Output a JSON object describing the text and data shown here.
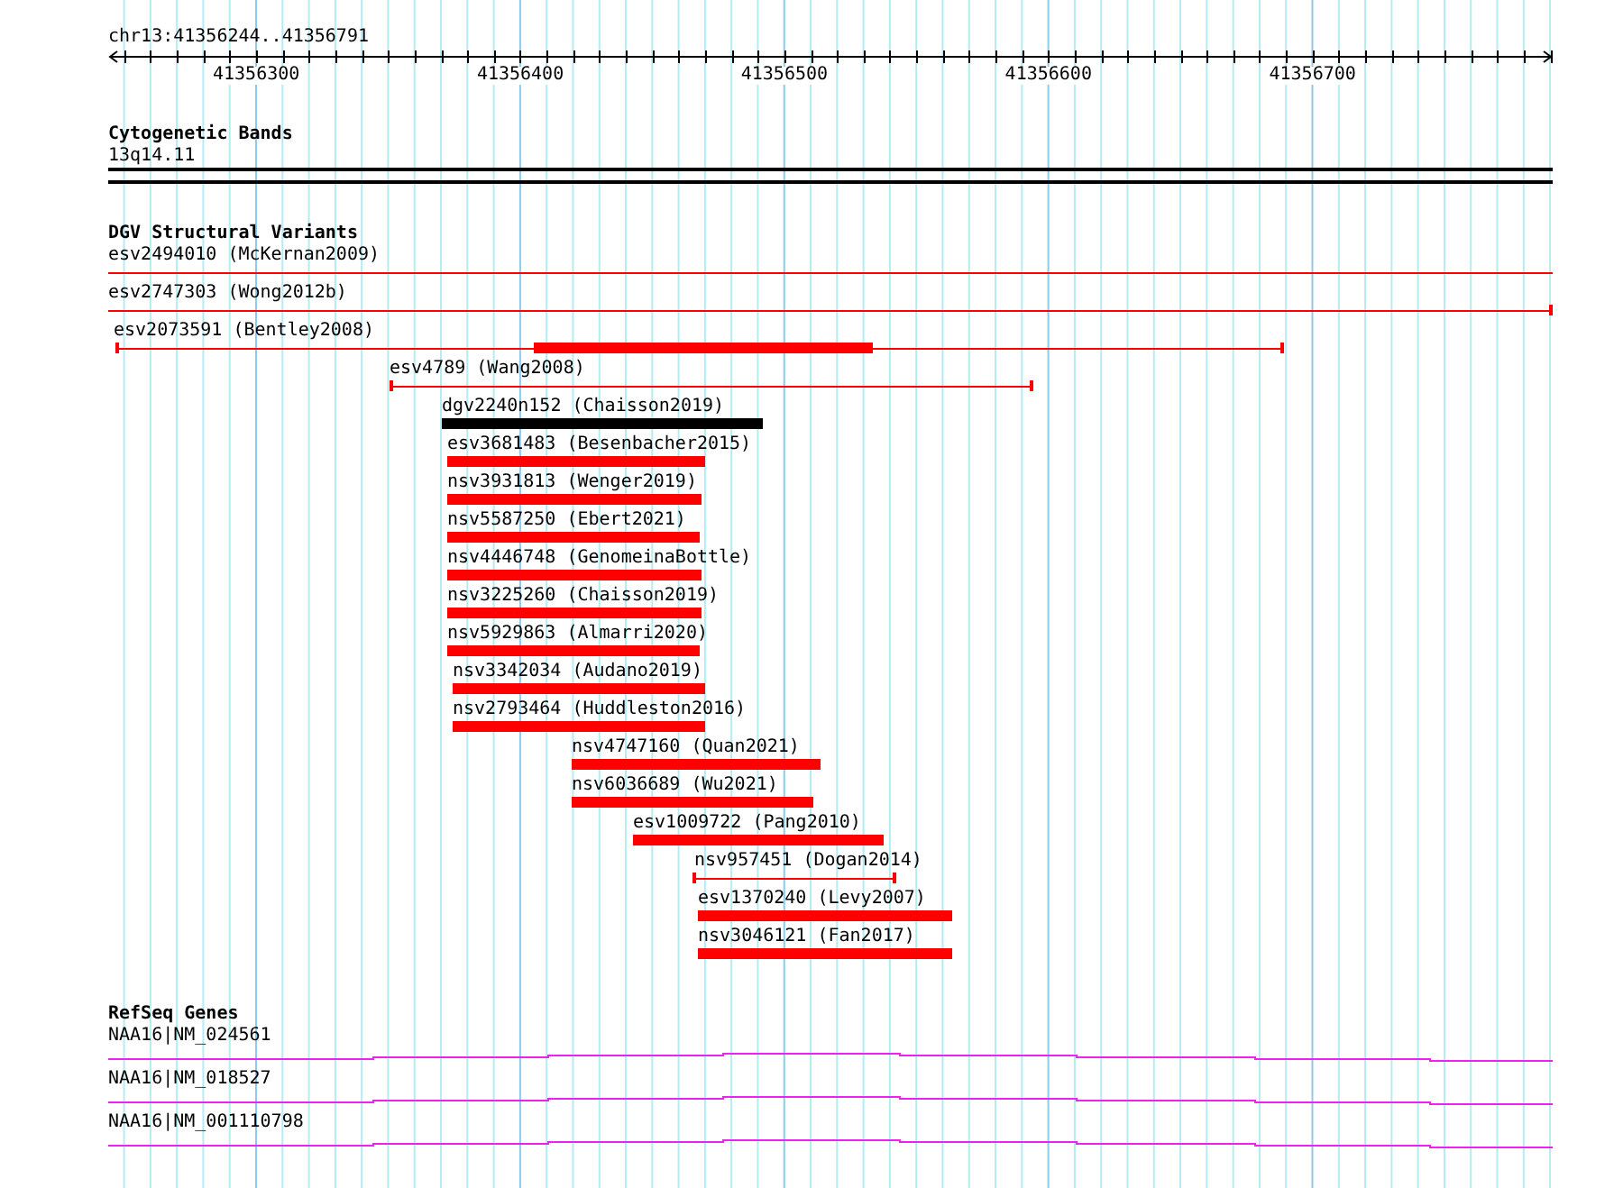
{
  "ruler": {
    "location": "chr13:41356244..41356791",
    "tick_labels": [
      "41356300",
      "41356400",
      "41356500",
      "41356600",
      "41356700"
    ]
  },
  "tracks": [
    {
      "kind": "bands",
      "title": "Cytogenetic Bands",
      "features": [
        {
          "label": "13q14.11"
        }
      ]
    },
    {
      "kind": "variants",
      "title": "DGV Structural Variants",
      "features": [
        {
          "label": "esv2494010 (McKernan2009)",
          "kind": "line",
          "color": "#ff0000"
        },
        {
          "label": "esv2747303 (Wong2012b)",
          "kind": "line",
          "color": "#ff0000"
        },
        {
          "label": "esv2073591 (Bentley2008)",
          "kind": "line",
          "color": "#ff0000"
        },
        {
          "label": "esv4789 (Wang2008)",
          "kind": "line",
          "color": "#ff0000"
        },
        {
          "label": "dgv2240n152 (Chaisson2019)",
          "kind": "bar",
          "color": "#000000"
        },
        {
          "label": "esv3681483 (Besenbacher2015)",
          "kind": "bar",
          "color": "#ff0000"
        },
        {
          "label": "nsv3931813 (Wenger2019)",
          "kind": "bar",
          "color": "#ff0000"
        },
        {
          "label": "nsv5587250 (Ebert2021)",
          "kind": "bar",
          "color": "#ff0000"
        },
        {
          "label": "nsv4446748 (GenomeinaBottle)",
          "kind": "bar",
          "color": "#ff0000"
        },
        {
          "label": "nsv3225260 (Chaisson2019)",
          "kind": "bar",
          "color": "#ff0000"
        },
        {
          "label": "nsv5929863 (Almarri2020)",
          "kind": "bar",
          "color": "#ff0000"
        },
        {
          "label": "nsv3342034 (Audano2019)",
          "kind": "bar",
          "color": "#ff0000"
        },
        {
          "label": "nsv2793464 (Huddleston2016)",
          "kind": "bar",
          "color": "#ff0000"
        },
        {
          "label": "nsv4747160 (Quan2021)",
          "kind": "bar",
          "color": "#ff0000"
        },
        {
          "label": "nsv6036689 (Wu2021)",
          "kind": "bar",
          "color": "#ff0000"
        },
        {
          "label": "esv1009722 (Pang2010)",
          "kind": "bar",
          "color": "#ff0000"
        },
        {
          "label": "nsv957451 (Dogan2014)",
          "kind": "line",
          "color": "#ff0000"
        },
        {
          "label": "esv1370240 (Levy2007)",
          "kind": "bar",
          "color": "#ff0000"
        },
        {
          "label": "nsv3046121 (Fan2017)",
          "kind": "bar",
          "color": "#ff0000"
        }
      ]
    },
    {
      "kind": "genes",
      "title": "RefSeq Genes",
      "features": [
        {
          "label": "NAA16|NM_024561"
        },
        {
          "label": "NAA16|NM_018527"
        },
        {
          "label": "NAA16|NM_001110798"
        }
      ]
    }
  ]
}
